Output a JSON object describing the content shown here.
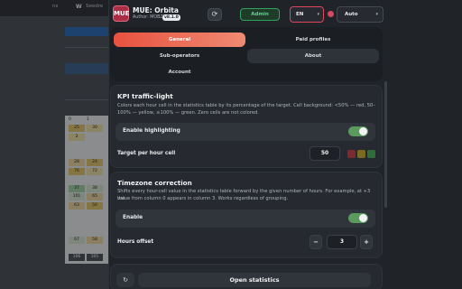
{
  "background": {
    "tab_fragment": "ns",
    "tab_logo": "W",
    "tab_label": "Seedre",
    "table": {
      "headers": [
        "0",
        "1"
      ],
      "rows": [
        [
          "25",
          "30"
        ],
        [
          "2",
          ""
        ],
        [
          "",
          ""
        ],
        [
          "",
          ""
        ],
        [
          "28",
          "24"
        ],
        [
          "76",
          "72"
        ],
        [
          "",
          ""
        ],
        [
          "37",
          "38"
        ],
        [
          "101",
          "65"
        ],
        [
          "63",
          "50"
        ],
        [
          "",
          ""
        ],
        [
          "",
          ""
        ],
        [
          "",
          ""
        ],
        [
          "67",
          "58"
        ],
        [
          "",
          ""
        ],
        [
          "306",
          "305"
        ]
      ]
    }
  },
  "header": {
    "logo_text": "MUE",
    "app_title": "MUE: Orbita",
    "author": "Author: MOBZU",
    "version": "v8.1.0",
    "admin_label": "Admin",
    "language": "EN",
    "theme": "Auto"
  },
  "tabs": [
    {
      "label": "General",
      "active": true
    },
    {
      "label": "Paid profiles",
      "active": false
    },
    {
      "label": "Sub-operators",
      "active": false
    },
    {
      "label": "About",
      "active": false
    },
    {
      "label": "Account",
      "active": false
    }
  ],
  "kpi": {
    "title": "KPI traffic-light",
    "description_line1": "Colors each hour cell in the statistics table by its percentage of the target. Cell background: <50% — red, 50–",
    "description_line2": "100% — yellow, ≥100% — green. Zero cells are not colored.",
    "highlight_label": "Enable highlighting",
    "highlight_enabled": true,
    "target_label": "Target per hour cell",
    "target_value": "50",
    "swatch_colors": [
      "#7a2a30",
      "#7a6a22",
      "#2f6e3a"
    ]
  },
  "timezone": {
    "title": "Timezone correction",
    "description_line1": "Shifts every hour-cell value in the statistics table forward by the given number of hours. For example, at +3 the",
    "description_line2": "value from column 0 appears in column 3. Works regardless of grouping.",
    "enable_label": "Enable",
    "enabled": true,
    "offset_label": "Hours offset",
    "offset_value": "3",
    "minus": "−",
    "plus": "+"
  },
  "footer": {
    "open_stats_label": "Open statistics"
  },
  "colors": {
    "accent_gradient_start": "#e8523f",
    "accent_gradient_end": "#f08a72",
    "toggle_on": "#5a9a5c",
    "admin_green": "#2fa35b",
    "brand": "#a92e45"
  }
}
